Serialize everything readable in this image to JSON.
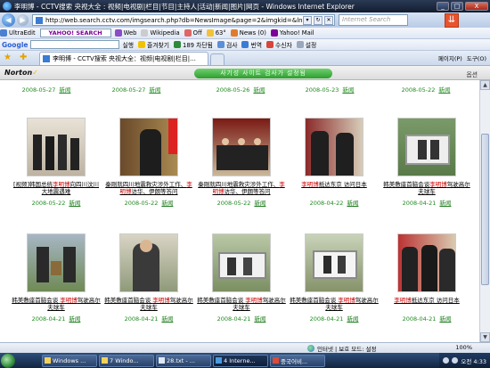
{
  "window": {
    "title": "李明博 - CCTV搜索 央视大全 : 视频|电视剧|栏目|节目|主持人|活动|新闻|图片|网页 - Windows Internet Explorer",
    "close_label": "X"
  },
  "address": {
    "url": "http://web.search.cctv.com/imgsearch.php?db=NewsImage&page=2&imgkid=&ln=zh_CN&q=%C0%EE%C3%F7",
    "search_placeholder": "Internet Search"
  },
  "toolbar1": {
    "items": [
      "UltraEdit",
      "YAHOO! SEARCH",
      "Web",
      "Wikipedia",
      "Off",
      "63°",
      "News (0)",
      "Yahoo! Mail"
    ]
  },
  "toolbar2": {
    "google_label": "Google",
    "items": [
      "실행",
      "즐겨찾기",
      "189 차단됨",
      "검사",
      "번역",
      "수신자",
      "설정"
    ]
  },
  "tabs": [
    {
      "label": "李明博 - CCTV搜索 央视大全：视频|电视剧|栏目|..."
    }
  ],
  "command_bar": [
    "페이지(P)",
    "도구(O)"
  ],
  "norton": {
    "logo": "Norton",
    "status": "사기성 사이트 검사가 설정됨",
    "options": "옵션"
  },
  "top_row": [
    {
      "date": "2008-05-27",
      "source": "新闻"
    },
    {
      "date": "2008-05-27",
      "source": "新闻"
    },
    {
      "date": "2008-05-26",
      "source": "新闻"
    },
    {
      "date": "2008-05-23",
      "source": "新闻"
    },
    {
      "date": "2008-05-22",
      "source": "新闻"
    }
  ],
  "grid": [
    [
      {
        "cap_a": "[视频]韩国总统",
        "kw": "李明博",
        "cap_b": "向四川汶川大地震遇难",
        "date": "2008-05-22",
        "source": "新闻"
      },
      {
        "cap_a": "秦刚就四川地震救灾涉外工作、",
        "kw": "李明博",
        "cap_b": "访华、伊朗等答问",
        "date": "2008-05-22",
        "source": "新闻"
      },
      {
        "cap_a": "秦刚就四川地震救灾涉外工作、",
        "kw": "李明博",
        "cap_b": "访华、伊朗等答问",
        "date": "2008-05-22",
        "source": "新闻"
      },
      {
        "cap_a": "",
        "kw": "李明博",
        "cap_b": "抵达东京 访问日本",
        "date": "2008-04-22",
        "source": "新闻"
      },
      {
        "cap_a": "韩美敷座首脑会谈",
        "kw": "李明博",
        "cap_b": "驾驶高尔夫球车",
        "date": "2008-04-21",
        "source": "新闻"
      }
    ],
    [
      {
        "cap_a": "韩美敷座首脑会谈 ",
        "kw": "李明博",
        "cap_b": "驾驶高尔夫球车",
        "date": "2008-04-21",
        "source": "新闻"
      },
      {
        "cap_a": "韩美敷座首脑会谈 ",
        "kw": "李明博",
        "cap_b": "驾驶高尔夫球车",
        "date": "2008-04-21",
        "source": "新闻"
      },
      {
        "cap_a": "韩美敷座首脑会谈 ",
        "kw": "李明博",
        "cap_b": "驾驶高尔夫球车",
        "date": "2008-04-21",
        "source": "新闻"
      },
      {
        "cap_a": "韩美敷座首脑会谈 ",
        "kw": "李明博",
        "cap_b": "驾驶高尔夫球车",
        "date": "2008-04-21",
        "source": "新闻"
      },
      {
        "cap_a": "",
        "kw": "李明博",
        "cap_b": "抵达东京 访问日本",
        "date": "2008-04-21",
        "source": "新闻"
      }
    ]
  ],
  "status": {
    "zone": "인터넷 | 보호 모드: 설정",
    "zoom": "100%"
  },
  "taskbar": {
    "tasks": [
      "Windows ...",
      "7 Windo...",
      "28.txt - ...",
      "4 Interne...",
      "중국어비..."
    ],
    "clock": "오전 4:33"
  }
}
